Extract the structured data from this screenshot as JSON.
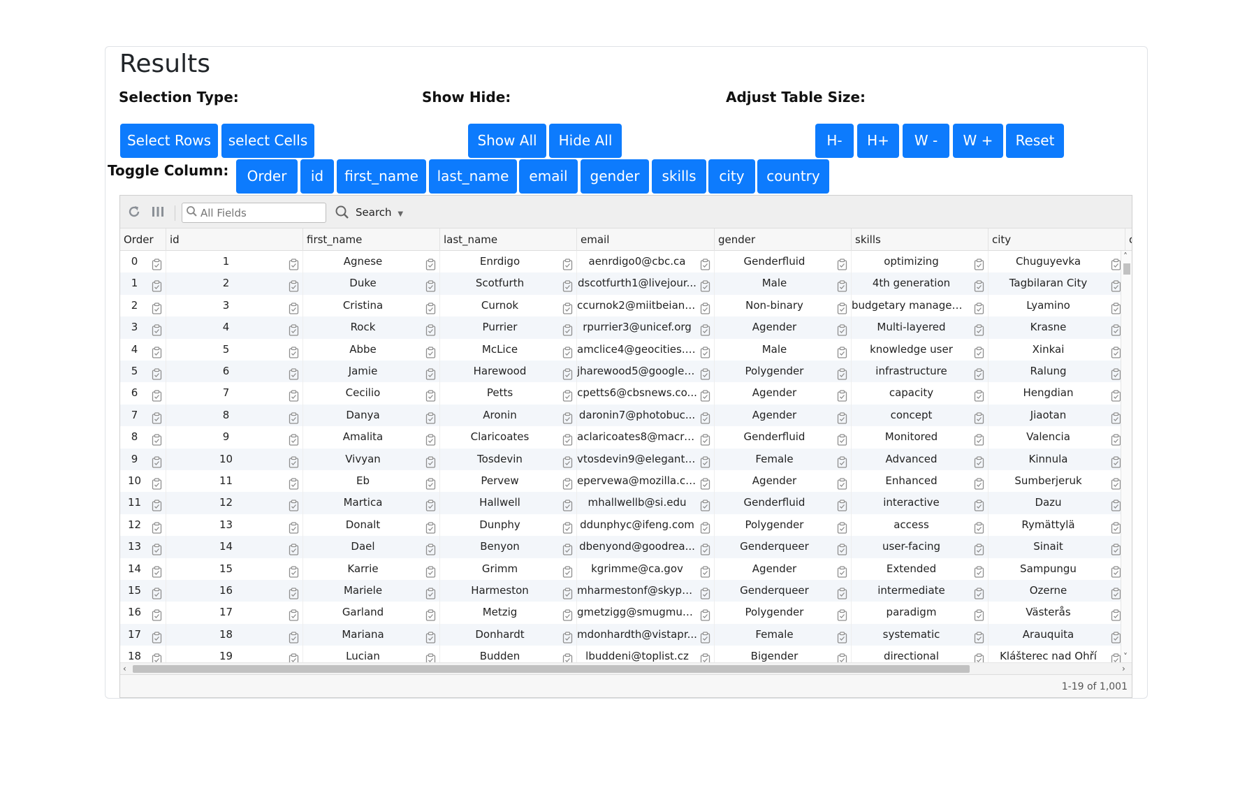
{
  "title": "Results",
  "sections": {
    "selection_type": "Selection Type:",
    "show_hide": "Show Hide:",
    "adjust_table_size": "Adjust Table Size:",
    "toggle_column": "Toggle Column:"
  },
  "buttons": {
    "select_rows": "Select Rows",
    "select_cells": "select Cells",
    "show_all": "Show All",
    "hide_all": "Hide All",
    "h_minus": "H-",
    "h_plus": "H+",
    "w_minus": "W -",
    "w_plus": "W +",
    "reset": "Reset"
  },
  "toggle_columns": [
    "Order",
    "id",
    "first_name",
    "last_name",
    "email",
    "gender",
    "skills",
    "city",
    "country"
  ],
  "toolbar": {
    "search_placeholder": "All Fields",
    "search_label": "Search",
    "icons": [
      "refresh-icon",
      "columns-icon",
      "search-icon",
      "chevron-down-icon"
    ]
  },
  "columns": [
    "Order",
    "id",
    "first_name",
    "last_name",
    "email",
    "gender",
    "skills",
    "city",
    "c"
  ],
  "rows": [
    [
      "0",
      "1",
      "Agnese",
      "Enrdigo",
      "aenrdigo0@cbc.ca",
      "Genderfluid",
      "optimizing",
      "Chuguyevka"
    ],
    [
      "1",
      "2",
      "Duke",
      "Scotfurth",
      "dscotfurth1@livejour...",
      "Male",
      "4th generation",
      "Tagbilaran City"
    ],
    [
      "2",
      "3",
      "Cristina",
      "Curnok",
      "ccurnok2@miitbeian....",
      "Non-binary",
      "budgetary managem...",
      "Lyamino"
    ],
    [
      "3",
      "4",
      "Rock",
      "Purrier",
      "rpurrier3@unicef.org",
      "Agender",
      "Multi-layered",
      "Krasne"
    ],
    [
      "4",
      "5",
      "Abbe",
      "McLice",
      "amclice4@geocities.c...",
      "Male",
      "knowledge user",
      "Xinkai"
    ],
    [
      "5",
      "6",
      "Jamie",
      "Harewood",
      "jharewood5@google....",
      "Polygender",
      "infrastructure",
      "Ralung"
    ],
    [
      "6",
      "7",
      "Cecilio",
      "Petts",
      "cpetts6@cbsnews.co...",
      "Agender",
      "capacity",
      "Hengdian"
    ],
    [
      "7",
      "8",
      "Danya",
      "Aronin",
      "daronin7@photobuc...",
      "Agender",
      "concept",
      "Jiaotan"
    ],
    [
      "8",
      "9",
      "Amalita",
      "Claricoates",
      "aclaricoates8@macro...",
      "Genderfluid",
      "Monitored",
      "Valencia"
    ],
    [
      "9",
      "10",
      "Vivyan",
      "Tosdevin",
      "vtosdevin9@elegantt...",
      "Female",
      "Advanced",
      "Kinnula"
    ],
    [
      "10",
      "11",
      "Eb",
      "Pervew",
      "epervewa@mozilla.co...",
      "Agender",
      "Enhanced",
      "Sumberjeruk"
    ],
    [
      "11",
      "12",
      "Martica",
      "Hallwell",
      "mhallwellb@si.edu",
      "Genderfluid",
      "interactive",
      "Dazu"
    ],
    [
      "12",
      "13",
      "Donalt",
      "Dunphy",
      "ddunphyc@ifeng.com",
      "Polygender",
      "access",
      "Rymättylä"
    ],
    [
      "13",
      "14",
      "Dael",
      "Benyon",
      "dbenyond@goodrea...",
      "Genderqueer",
      "user-facing",
      "Sinait"
    ],
    [
      "14",
      "15",
      "Karrie",
      "Grimm",
      "kgrimme@ca.gov",
      "Agender",
      "Extended",
      "Sampungu"
    ],
    [
      "15",
      "16",
      "Mariele",
      "Harmeston",
      "mharmestonf@skype...",
      "Genderqueer",
      "intermediate",
      "Ozerne"
    ],
    [
      "16",
      "17",
      "Garland",
      "Metzig",
      "gmetzigg@smugmug...",
      "Polygender",
      "paradigm",
      "Västerås"
    ],
    [
      "17",
      "18",
      "Mariana",
      "Donhardt",
      "mdonhardth@vistapr...",
      "Female",
      "systematic",
      "Arauquita"
    ],
    [
      "18",
      "19",
      "Lucian",
      "Budden",
      "lbuddeni@toplist.cz",
      "Bigender",
      "directional",
      "Klášterec nad Ohří"
    ]
  ],
  "footer": "1-19 of 1,001",
  "colors": {
    "primary_button": "#0d7bfd",
    "row_alt": "#f3f6fa",
    "toolbar_bg": "#efefef"
  }
}
